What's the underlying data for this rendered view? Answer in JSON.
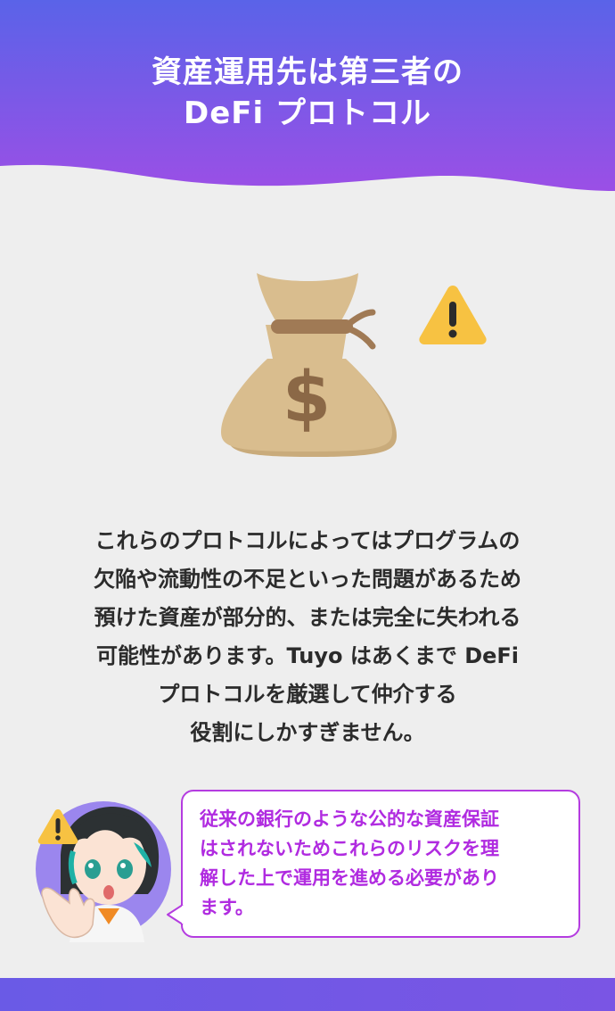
{
  "header": {
    "title_line1": "資産運用先は第三者の",
    "title_line2": "DeFi プロトコル",
    "gradient_top": "#5a63e8",
    "gradient_bottom": "#9b4fe6"
  },
  "illustration": {
    "bag_icon": "money-bag-icon",
    "bag_color": "#d9bd8e",
    "currency_symbol": "$",
    "warning_icon": "warning-triangle-icon",
    "warning_color": "#f7c242"
  },
  "body": {
    "lines": [
      "これらのプロトコルによってはプログラムの",
      "欠陥や流動性の不足といった問題があるため",
      "預けた資産が部分的、または完全に失われる",
      "可能性があります。Tuyo はあくまで DeFi",
      "プロトコルを厳選して仲介する",
      "役割にしかすぎません。"
    ]
  },
  "speech": {
    "accent_color": "#b43ce0",
    "lines": [
      "従来の銀行のような公的な資産保証",
      "はされないためこれらのリスクを理",
      "解した上で運用を進める必要があり",
      "ます。"
    ]
  },
  "footer": {
    "color": "#6a5ae6"
  }
}
